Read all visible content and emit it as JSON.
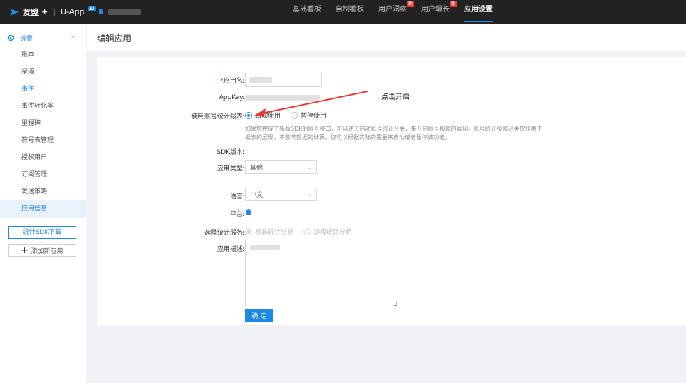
{
  "topbar": {
    "brand": "友盟",
    "plus": "+",
    "sep": "|",
    "product": "U-App",
    "ai_badge": "AI",
    "nav": [
      {
        "label": "基础看板",
        "active": false,
        "new": false
      },
      {
        "label": "自制看板",
        "active": false,
        "new": false
      },
      {
        "label": "用户洞察",
        "active": false,
        "new": true
      },
      {
        "label": "用户增长",
        "active": false,
        "new": true
      },
      {
        "label": "应用设置",
        "active": true,
        "new": false
      }
    ],
    "new_badge": "新"
  },
  "sidebar": {
    "section": "设置",
    "items": [
      {
        "label": "版本",
        "active": false,
        "blue": false
      },
      {
        "label": "渠道",
        "active": false,
        "blue": false
      },
      {
        "label": "事件",
        "active": false,
        "blue": true
      },
      {
        "label": "事件转化率",
        "active": false,
        "blue": false
      },
      {
        "label": "里程碑",
        "active": false,
        "blue": false
      },
      {
        "label": "符号表管理",
        "active": false,
        "blue": false
      },
      {
        "label": "授权用户",
        "active": false,
        "blue": false
      },
      {
        "label": "订阅管理",
        "active": false,
        "blue": false
      },
      {
        "label": "发送策略",
        "active": false,
        "blue": false
      },
      {
        "label": "应用信息",
        "active": true,
        "blue": true
      }
    ],
    "sdk_button": "统计SDK下载",
    "add_button": "添加新应用"
  },
  "page": {
    "title": "编辑应用"
  },
  "form": {
    "app_name_label": "应用名:",
    "required_mark": "*",
    "appkey_label": "AppKey:",
    "account_stats_label": "使用账号统计报表:",
    "account_stats_options": [
      {
        "label": "启动使用",
        "checked": true
      },
      {
        "label": "暂停使用",
        "checked": false
      }
    ],
    "account_stats_help": "如果您完成了新版SDK的账号接口，可以通过启动账号统计开关，来开启账号报表的展现。账号统计报表开关仅作用于报表的展现，不影响数据的计算。您可以根据实际的需要来启动或者暂停该功能。",
    "sdk_version_label": "SDK版本:",
    "app_type_label": "应用类型:",
    "app_type_value": "其他",
    "language_label": "语言:",
    "language_value": "中文",
    "platform_label": "平台:",
    "service_label": "选择统计服务:",
    "service_options": [
      {
        "label": "标准统计分析",
        "checked": true
      },
      {
        "label": "游戏统计分析",
        "checked": false
      }
    ],
    "desc_label": "应用描述:",
    "confirm_button": "确 定"
  },
  "annotation": "点击开启",
  "colors": {
    "accent": "#1e88e5",
    "topbar": "#222222",
    "arrow": "#e53935"
  }
}
